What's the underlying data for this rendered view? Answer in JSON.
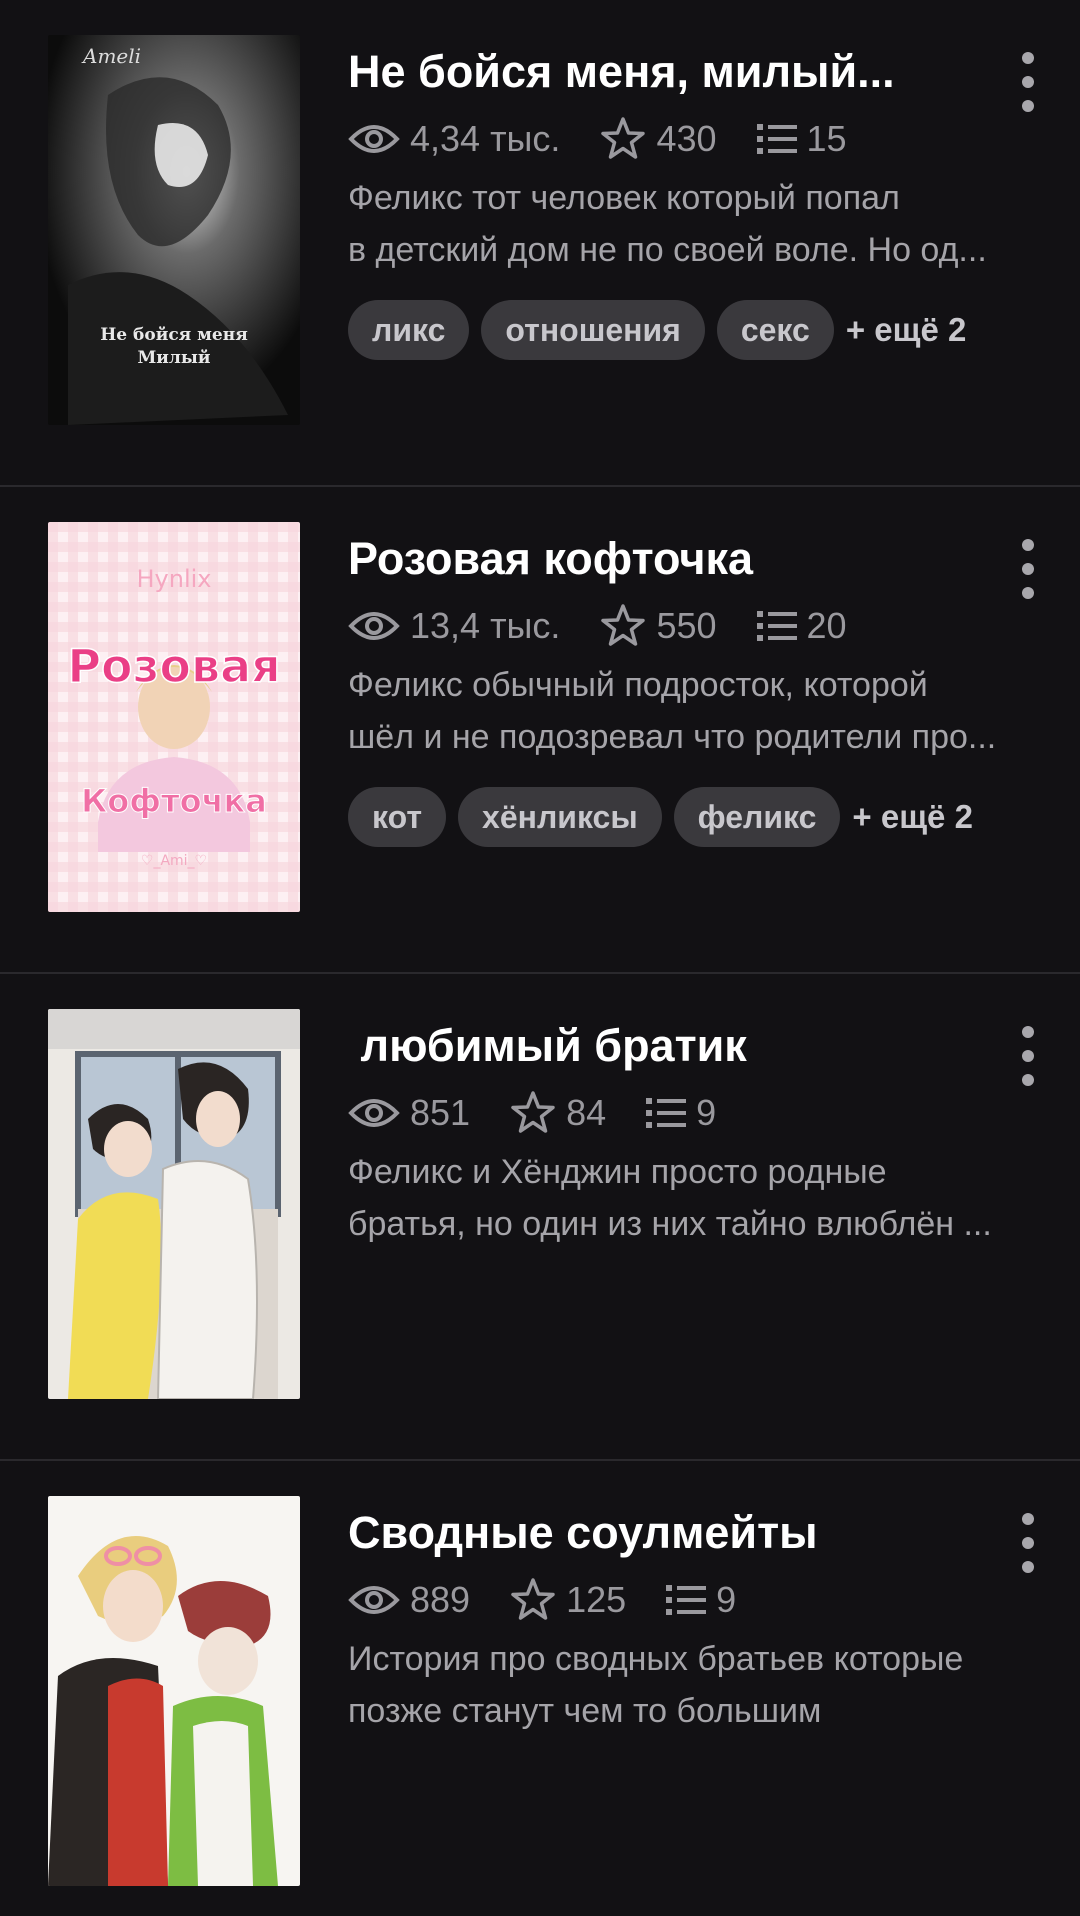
{
  "colors": {
    "background": "#121114",
    "divider": "#2a292d",
    "tag_bg": "#3a393d",
    "stat_text": "#9a999e"
  },
  "icons": {
    "views": "eye-icon",
    "votes": "star-icon",
    "parts": "list-icon",
    "menu": "more-vertical-icon"
  },
  "stories": [
    {
      "title": "Не бойся меня, милый...",
      "views": "4,34 тыс.",
      "votes": "430",
      "parts": "15",
      "desc_line1": "Феликс тот человек который попал",
      "desc_line2": "в детский дом не по своей воле. Но од...",
      "tags": [
        "ликс",
        "отношения",
        "секс"
      ],
      "more_tags": "+ ещё 2",
      "cover": {
        "top_text": "Ameli",
        "mid_text1": "Не бойся меня",
        "mid_text2": "Милый"
      }
    },
    {
      "title": "Розовая кофточка",
      "views": "13,4 тыс.",
      "votes": "550",
      "parts": "20",
      "desc_line1": "Феликс обычный подросток, которой",
      "desc_line2": "шёл и не подозревал что родители про...",
      "tags": [
        "кот",
        "хёнликсы",
        "феликс"
      ],
      "more_tags": "+ ещё 2",
      "cover": {
        "top_text": "Hynlix",
        "big1": "Розовая",
        "big2": "Кофточка",
        "sign": "♡_Ami_♡"
      }
    },
    {
      "title": " любимый братик",
      "views": "851",
      "votes": "84",
      "parts": "9",
      "desc_line1": "Феликс и Хёнджин просто родные",
      "desc_line2": "братья, но один из них тайно влюблён ..."
    },
    {
      "title": "Сводные соулмейты",
      "views": "889",
      "votes": "125",
      "parts": "9",
      "desc_line1": "История про сводных братьев которые",
      "desc_line2": "позже станут чем то большим"
    }
  ]
}
